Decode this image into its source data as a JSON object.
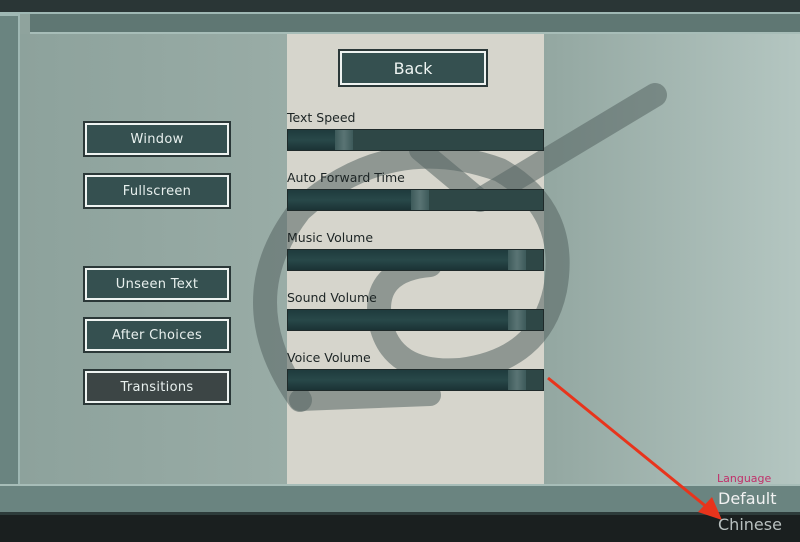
{
  "menu": {
    "back_label": "Back",
    "display_buttons": [
      {
        "label": "Window",
        "selected": false
      },
      {
        "label": "Fullscreen",
        "selected": false
      }
    ],
    "skip_buttons": [
      {
        "label": "Unseen Text",
        "selected": false
      },
      {
        "label": "After Choices",
        "selected": false
      },
      {
        "label": "Transitions",
        "selected": true
      }
    ]
  },
  "sliders": [
    {
      "label": "Text Speed",
      "value": 0.2
    },
    {
      "label": "Auto Forward Time",
      "value": 0.52
    },
    {
      "label": "Music Volume",
      "value": 0.93
    },
    {
      "label": "Sound Volume",
      "value": 0.93
    },
    {
      "label": "Voice Volume",
      "value": 0.93
    }
  ],
  "language": {
    "title": "Language",
    "options": [
      "Default",
      "Chinese"
    ],
    "selected": "Default"
  },
  "colors": {
    "button_bg": "#355050",
    "button_selected_bg": "#3c4545",
    "language_title": "#c0306a",
    "annotation_arrow": "#e8341c"
  }
}
